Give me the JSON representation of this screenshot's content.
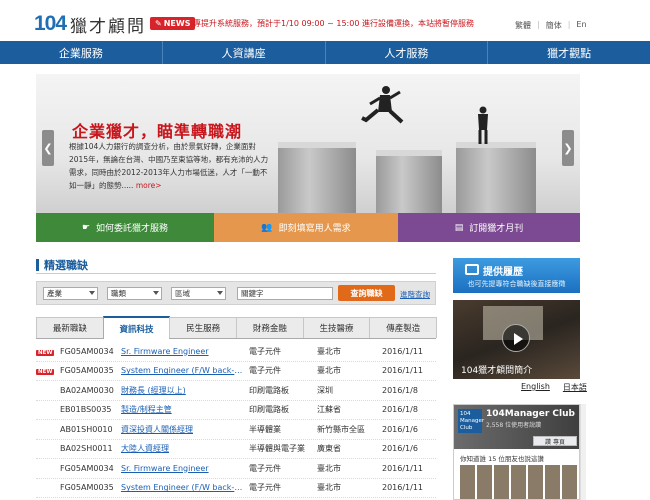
{
  "header": {
    "logo_number": "104",
    "logo_text": "獵才顧問",
    "news_badge": "NEWS",
    "notice": "專提升系統服務，預計于1/10 09:00 ~ 15:00 進行設備運換，本站將暫停服務",
    "lang_links": [
      "繁體",
      "簡体",
      "En"
    ]
  },
  "nav": [
    "企業服務",
    "人資講座",
    "人才服務",
    "獵才觀點"
  ],
  "banner": {
    "headline": "企業獵才，瞄準轉職潮",
    "body": "根據104人力銀行的調查分析，由於景氣好轉，企業面對2015年，無論在台灣、中國乃至東協等地，都有充沛的人力需求，同時由於2012-2013年人力市場低迷，人才「一動不如一靜」的態勢.....",
    "more": "more>",
    "prev": "❮",
    "next": "❯"
  },
  "cta": [
    {
      "label": "如何委託獵才服務",
      "color": "#3e8a3a"
    },
    {
      "label": "即刻填寫用人需求",
      "color": "#e5984d"
    },
    {
      "label": "訂閱獵才月刊",
      "color": "#7b4a93"
    }
  ],
  "jobs_section": {
    "title": "精選職缺",
    "filters": [
      "產業",
      "職類",
      "區域"
    ],
    "keyword_placeholder": "關鍵字",
    "search_button": "查詢職缺",
    "advanced_link": "進階查詢",
    "tabs": [
      "最新職缺",
      "資訊科技",
      "民生服務",
      "財務金融",
      "生技醫療",
      "傳產製造"
    ],
    "active_tab": "資訊科技",
    "rows": [
      {
        "new": "NEW",
        "code": "FG05AM0034",
        "title": "Sr. Firmware Engineer",
        "industry": "電子元件",
        "location": "臺北市",
        "date": "2016/1/11"
      },
      {
        "new": "NEW",
        "code": "FG05AM0035",
        "title": "System Engineer (F/W back-end)",
        "industry": "電子元件",
        "location": "臺北市",
        "date": "2016/1/11"
      },
      {
        "new": "",
        "code": "BA02AM0030",
        "title": "財務長 (經理以上)",
        "industry": "印刷電路板",
        "location": "深圳",
        "date": "2016/1/8"
      },
      {
        "new": "",
        "code": "EB01BS0035",
        "title": "製造/制程主管",
        "industry": "印刷電路板",
        "location": "江蘇省",
        "date": "2016/1/8"
      },
      {
        "new": "",
        "code": "AB01SH0010",
        "title": "資深投資人關係經理",
        "industry": "半導體業",
        "location": "新竹縣市全區",
        "date": "2016/1/6"
      },
      {
        "new": "",
        "code": "BA02SH0011",
        "title": "大陸人資經理",
        "industry": "半導體與電子業",
        "location": "廣東省",
        "date": "2016/1/6"
      },
      {
        "new": "",
        "code": "FG05AM0034",
        "title": "Sr. Firmware Engineer",
        "industry": "電子元件",
        "location": "臺北市",
        "date": "2016/1/11"
      },
      {
        "new": "",
        "code": "FG05AM0035",
        "title": "System Engineer (F/W back-end)",
        "industry": "電子元件",
        "location": "臺北市",
        "date": "2016/1/11"
      }
    ]
  },
  "sidebar": {
    "resume_title": "提供履歷",
    "resume_sub": "也可先提專符合職缺後直接應徵",
    "video_caption": "104獵才顧問簡介",
    "video_langs": [
      "English",
      "日本語"
    ],
    "club_logo": "104 Manager Club",
    "club_name": "104Manager Club",
    "club_sub": "2,558 位使用者說讚",
    "club_like": "讚 專頁",
    "club_post": "你知道誰 15 位朋友也說這讚"
  }
}
